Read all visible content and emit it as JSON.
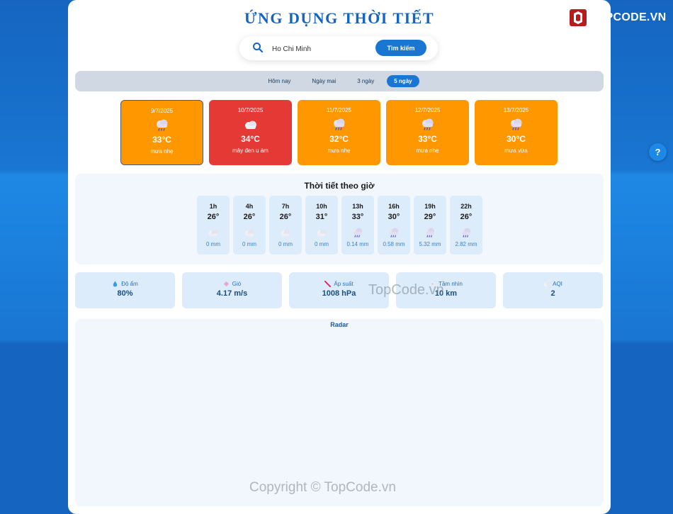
{
  "app": {
    "title": "ỨNG DỤNG THỜI TIẾT"
  },
  "search": {
    "value": "Ho Chi Minh",
    "button_label": "Tìm kiếm"
  },
  "tabs": [
    {
      "label": "Hôm nay",
      "active": false
    },
    {
      "label": "Ngày mai",
      "active": false
    },
    {
      "label": "3 ngày",
      "active": false
    },
    {
      "label": "5 ngày",
      "active": true
    }
  ],
  "days": [
    {
      "date": "9/7/2025",
      "temp": "33°C",
      "desc": "mưa nhẹ",
      "icon": "rain-cloud-icon",
      "color": "#ff9800",
      "selected": true
    },
    {
      "date": "10/7/2025",
      "temp": "34°C",
      "desc": "mây đen u ám",
      "icon": "cloud-icon",
      "color": "#e53935",
      "selected": false
    },
    {
      "date": "11/7/2025",
      "temp": "32°C",
      "desc": "mưa nhẹ",
      "icon": "rain-cloud-icon",
      "color": "#ff9800",
      "selected": false
    },
    {
      "date": "12/7/2025",
      "temp": "33°C",
      "desc": "mưa nhẹ",
      "icon": "rain-cloud-icon",
      "color": "#ff9800",
      "selected": false
    },
    {
      "date": "13/7/2025",
      "temp": "30°C",
      "desc": "mưa vừa",
      "icon": "rain-cloud-icon",
      "color": "#ff9800",
      "selected": false
    }
  ],
  "hourly": {
    "title": "Thời tiết theo giờ",
    "items": [
      {
        "time": "1h",
        "temp": "26°",
        "rain": "0 mm",
        "icon": "cloud-icon"
      },
      {
        "time": "4h",
        "temp": "26°",
        "rain": "0 mm",
        "icon": "cloud-icon"
      },
      {
        "time": "7h",
        "temp": "26°",
        "rain": "0 mm",
        "icon": "cloud-icon"
      },
      {
        "time": "10h",
        "temp": "31°",
        "rain": "0 mm",
        "icon": "cloud-icon"
      },
      {
        "time": "13h",
        "temp": "33°",
        "rain": "0.14 mm",
        "icon": "rain-cloud-icon"
      },
      {
        "time": "16h",
        "temp": "30°",
        "rain": "0.58 mm",
        "icon": "rain-cloud-icon"
      },
      {
        "time": "19h",
        "temp": "29°",
        "rain": "5.32 mm",
        "icon": "rain-cloud-icon"
      },
      {
        "time": "22h",
        "temp": "26°",
        "rain": "2.82 mm",
        "icon": "rain-cloud-icon"
      }
    ]
  },
  "stats": [
    {
      "label": "Độ ẩm",
      "value": "80%",
      "icon": "droplet-icon"
    },
    {
      "label": "Gió",
      "value": "4.17 m/s",
      "icon": "wind-icon"
    },
    {
      "label": "Áp suất",
      "value": "1008 hPa",
      "icon": "gauge-icon"
    },
    {
      "label": "Tầm nhìn",
      "value": "10 km",
      "icon": "eye-icon"
    },
    {
      "label": "AQI",
      "value": "2",
      "icon": "air-icon"
    }
  ],
  "radar": {
    "label": "Radar"
  },
  "watermark": {
    "middle": "TopCode.vn",
    "bottom": "Copyright © TopCode.vn"
  },
  "brand": {
    "logo_text": "TOPCODE.VN"
  },
  "help": {
    "label": "?"
  }
}
